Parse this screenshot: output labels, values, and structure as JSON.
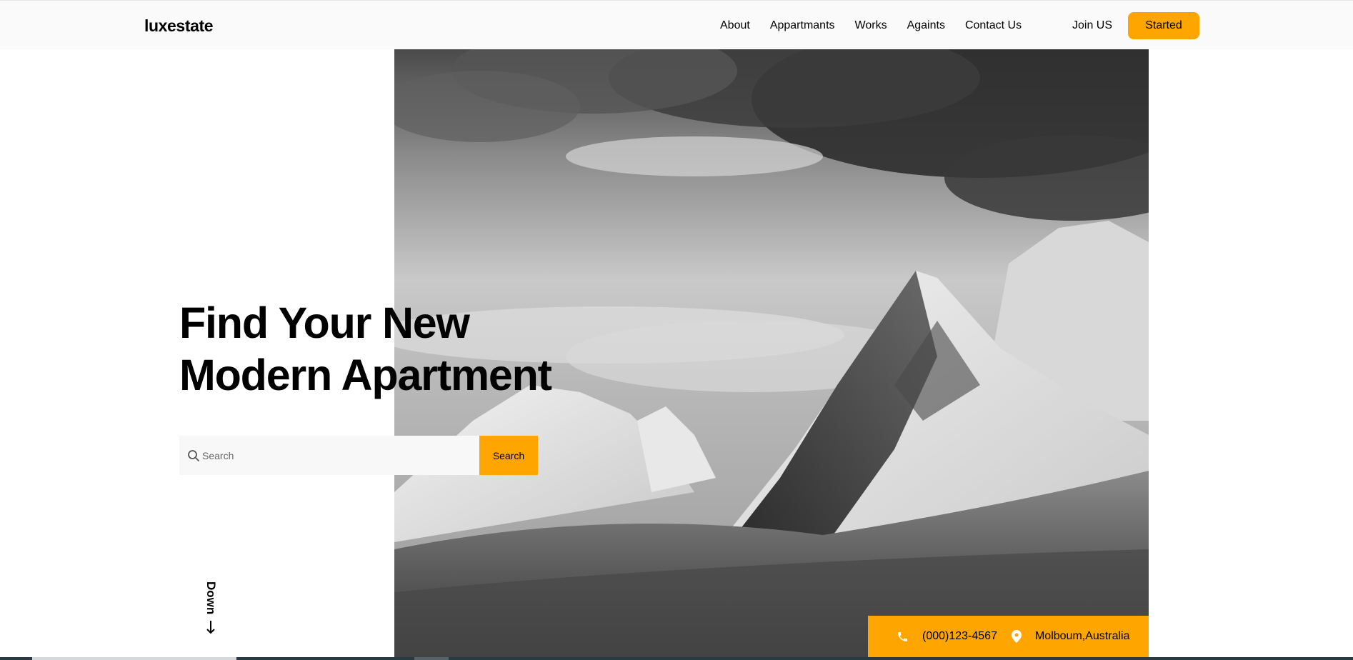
{
  "brand": {
    "name": "luxestate"
  },
  "nav": {
    "items": [
      "About",
      "Appartmants",
      "Works",
      "Againts",
      "Contact Us"
    ],
    "join_label": "Join US",
    "started_label": "Started"
  },
  "hero": {
    "headline_line1": "Find Your New",
    "headline_line2": "Modern Apartment",
    "image_alt": "black-and-white snowy mountain peaks under cloudy sky"
  },
  "search": {
    "placeholder": "Search",
    "button_label": "Search"
  },
  "scroll": {
    "label": "Down"
  },
  "contact": {
    "phone": "(000)123-4567",
    "location": "Molboum,Australia"
  },
  "colors": {
    "accent": "#ffa500",
    "topbar_bg": "#fafafa",
    "search_bg": "#f8f8f8"
  },
  "icons": {
    "search": "search-icon",
    "phone": "phone-icon",
    "location": "map-pin-icon",
    "down": "arrow-down-icon"
  }
}
